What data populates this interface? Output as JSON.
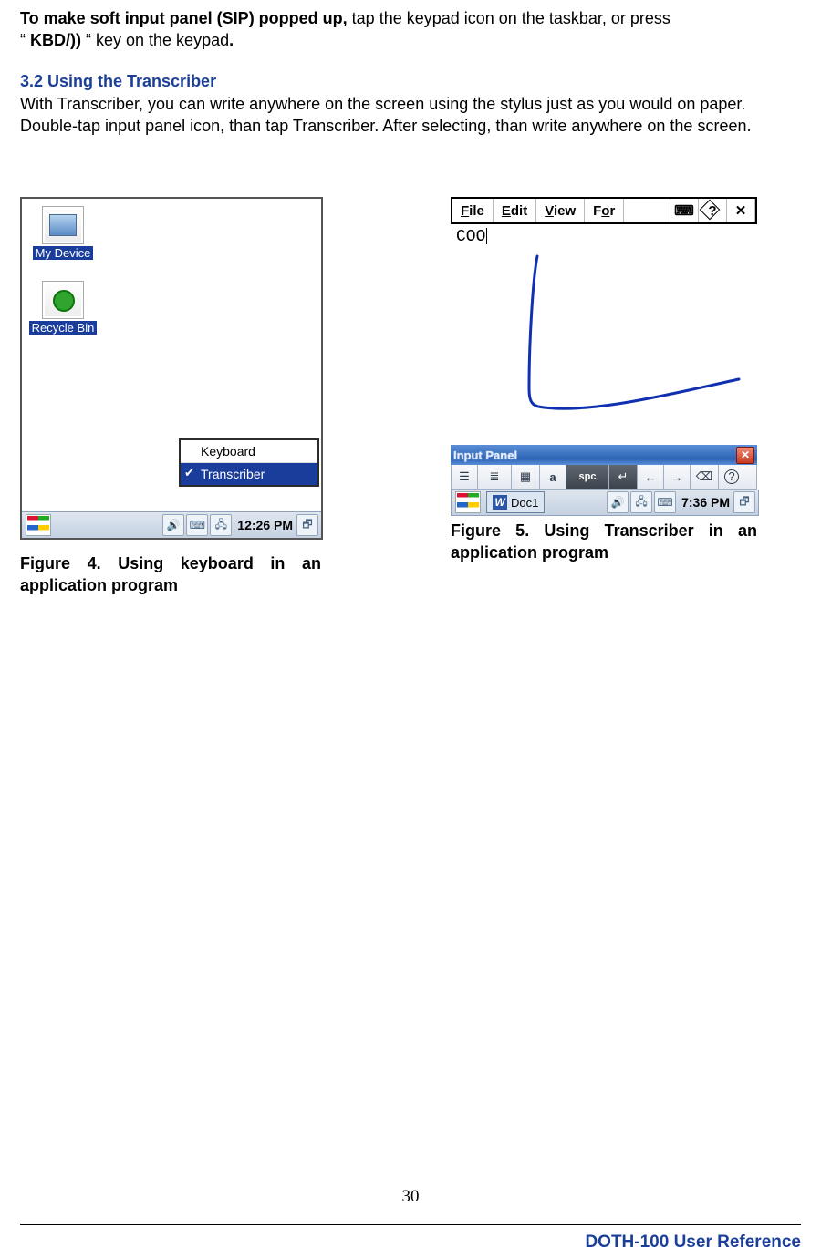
{
  "intro": {
    "bold_prefix": "To make soft input panel (SIP) popped up,",
    "rest1": " tap the keypad icon on the taskbar, or press",
    "line2_openquote": "“ ",
    "kbd": "KBD/)) ",
    "line2_rest": "“  key on the keypad",
    "dot": "."
  },
  "section": {
    "heading": "3.2 Using the Transcriber",
    "body": "With Transcriber, you can write anywhere on the screen using the stylus just as you would on paper. Double-tap input panel icon, than tap Transcriber. After selecting, than write anywhere on the screen."
  },
  "fig4": {
    "mydevice": "My Device",
    "recycle": "Recycle Bin",
    "menu_keyboard": "Keyboard",
    "menu_transcriber": "Transcriber",
    "time": "12:26 PM",
    "caption": "Figure 4. Using keyboard in an application program"
  },
  "fig5": {
    "menubar": {
      "file": "File",
      "edit": "Edit",
      "view": "View",
      "for": "For"
    },
    "typed": "COO",
    "input_panel_title": "Input Panel",
    "a_label": "a",
    "spc_label": "spc",
    "doc": "Doc1",
    "time": "7:36 PM",
    "caption": "Figure 5. Using Transcriber in an application program"
  },
  "footer": {
    "page": "30",
    "ref": "DOTH-100 User Reference"
  }
}
